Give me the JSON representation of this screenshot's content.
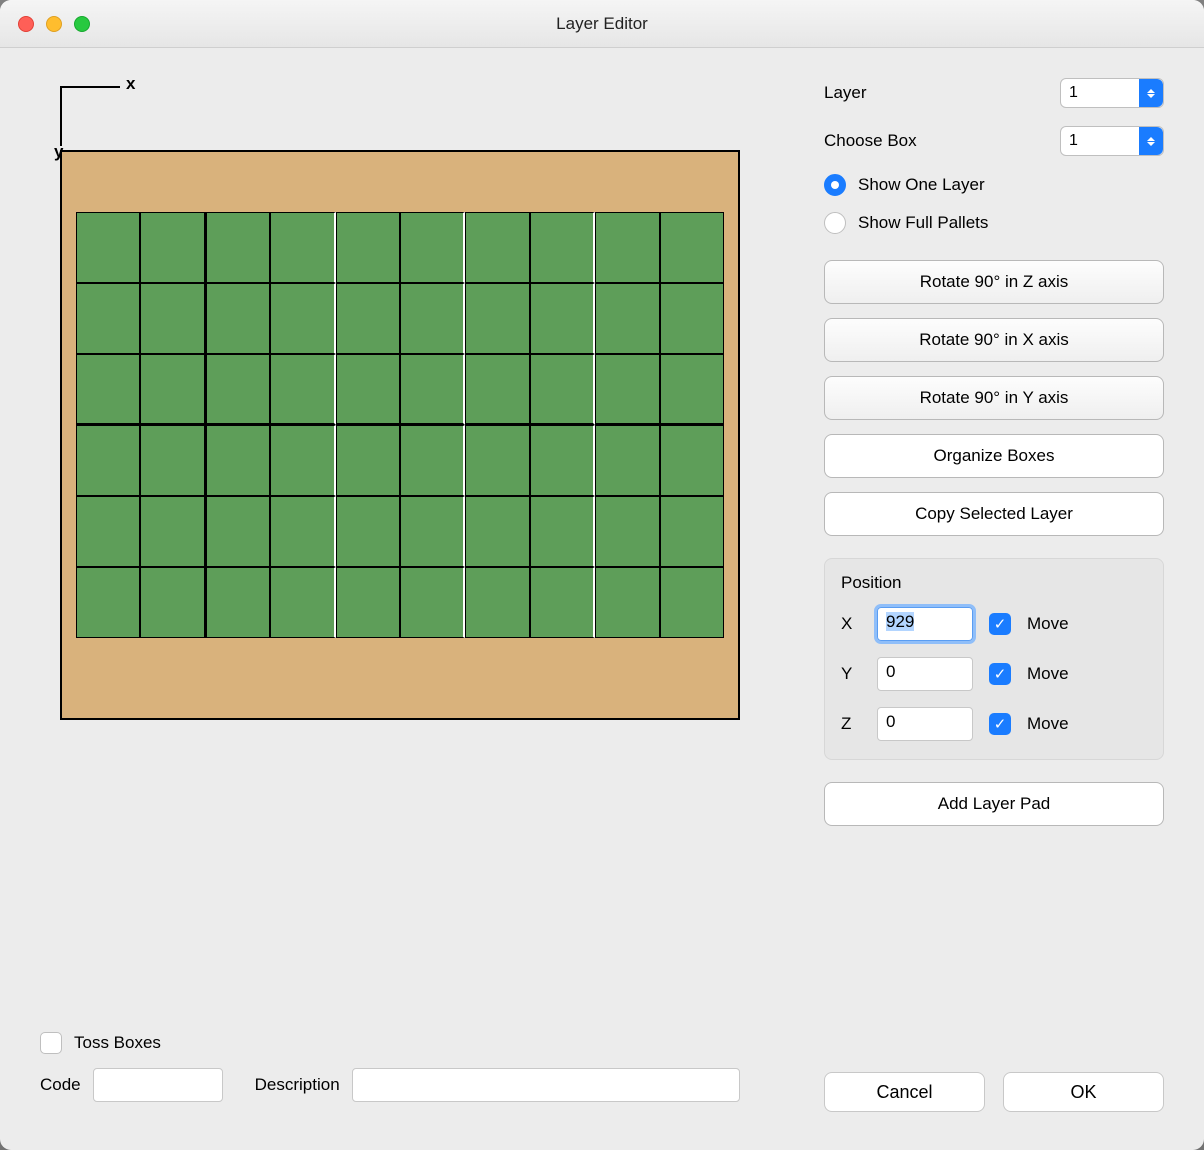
{
  "window": {
    "title": "Layer Editor"
  },
  "axis": {
    "x_label": "x",
    "y_label": "y"
  },
  "controls": {
    "layer_label": "Layer",
    "layer_value": "1",
    "choose_box_label": "Choose Box",
    "choose_box_value": "1",
    "show_one_layer": "Show One Layer",
    "show_full_pallets": "Show Full Pallets",
    "display_mode": "one",
    "rotate_z": "Rotate 90° in Z axis",
    "rotate_x": "Rotate 90° in X axis",
    "rotate_y": "Rotate 90° in Y axis",
    "organize": "Organize Boxes",
    "copy_layer": "Copy Selected Layer"
  },
  "position": {
    "title": "Position",
    "x_label": "X",
    "y_label": "Y",
    "z_label": "Z",
    "x": "929",
    "y": "0",
    "z": "0",
    "move_label": "Move",
    "x_move": true,
    "y_move": true,
    "z_move": true
  },
  "add_layer_pad": "Add Layer Pad",
  "toss_boxes_label": "Toss Boxes",
  "toss_boxes_checked": false,
  "code_label": "Code",
  "code_value": "",
  "description_label": "Description",
  "description_value": "",
  "footer": {
    "cancel": "Cancel",
    "ok": "OK"
  },
  "grid": {
    "rows": 6,
    "cols": 10
  }
}
